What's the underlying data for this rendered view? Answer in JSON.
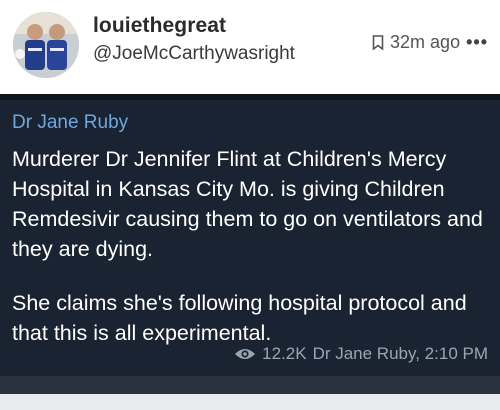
{
  "post": {
    "username": "louiethegreat",
    "handle": "@JoeMcCarthywasright",
    "time_ago": "32m ago",
    "more_icon": "more-dots-icon",
    "bookmark_icon": "bookmark-icon"
  },
  "embed": {
    "channel_name": "Dr Jane Ruby",
    "message_paragraphs": [
      "Murderer Dr Jennifer Flint at Children's Mercy Hospital in Kansas City Mo. is giving Children Remdesivir causing them to go on ventilators and they are dying.",
      "She claims she's following hospital protocol and that this is all experimental."
    ],
    "views": "12.2K",
    "author_time": "Dr Jane Ruby, 2:10 PM",
    "views_icon": "eye-icon"
  },
  "colors": {
    "embed_bg": "#1a2331",
    "channel_name": "#6fa7df",
    "message_text": "#ffffff"
  }
}
